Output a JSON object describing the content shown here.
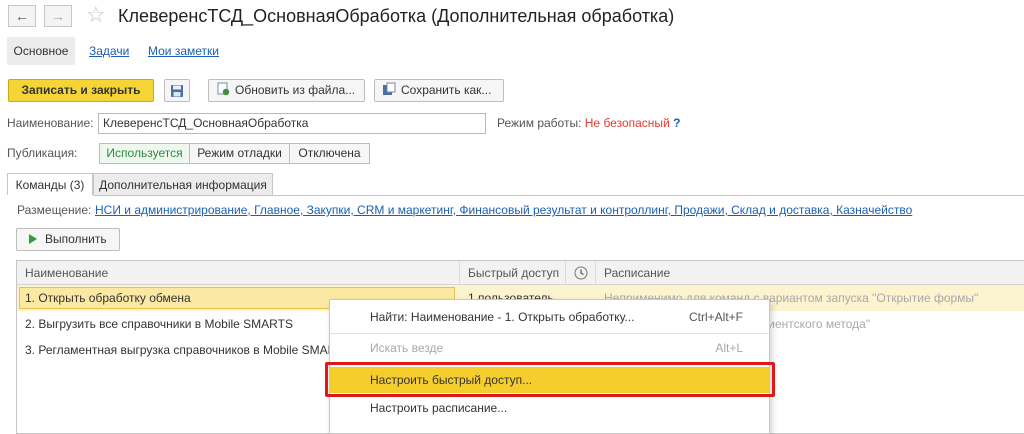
{
  "window": {
    "title": "КлеверенсТСД_ОсновнаяОбработка (Дополнительная обработка)",
    "back_icon": "←",
    "forward_icon": "→",
    "favorite_icon": "☆"
  },
  "sections": {
    "active": "Основное",
    "links": [
      "Задачи",
      "Мои заметки"
    ]
  },
  "toolbar": {
    "save_close": "Записать и закрыть",
    "update_from_file": "Обновить из файла...",
    "save_as": "Сохранить как..."
  },
  "form": {
    "name_label": "Наименование:",
    "name_value": "КлеверенсТСД_ОсновнаяОбработка",
    "mode_label": "Режим работы:",
    "mode_value": "Не безопасный",
    "mode_help": "?",
    "publication_label": "Публикация:",
    "publication_options": [
      "Используется",
      "Режим отладки",
      "Отключена"
    ],
    "publication_selected": "Используется"
  },
  "form_tabs": [
    "Команды (3)",
    "Дополнительная информация"
  ],
  "commands": {
    "placement_label": "Размещение:",
    "placement_value": "НСИ и администрирование, Главное, Закупки, CRM и маркетинг, Финансовый результат и контроллинг, Продажи, Склад и доставка, Казначейство",
    "run_button": "Выполнить",
    "table": {
      "columns": [
        "Наименование",
        "Быстрый доступ",
        "",
        "Расписание"
      ],
      "rows": [
        {
          "name": "1. Открыть обработку обмена",
          "quick_access": "1 пользователь",
          "schedule": "Неприменимо для команд с вариантом запуска \"Открытие формы\""
        },
        {
          "name": "2. Выгрузить все справочники в Mobile SMARTS",
          "quick_access": "",
          "schedule": "вариантом запуска \"Вызов клиентского метода\""
        },
        {
          "name": "3. Регламентная выгрузка справочников в Mobile SMARTS",
          "quick_access": "",
          "schedule": ""
        }
      ]
    }
  },
  "context_menu": {
    "items": [
      {
        "label": "Найти: Наименование - 1. Открыть обработку...",
        "shortcut": "Ctrl+Alt+F"
      },
      {
        "label": "Искать везде",
        "shortcut": "Alt+L"
      },
      {
        "label": "Настроить быстрый доступ...",
        "shortcut": ""
      },
      {
        "label": "Настроить расписание...",
        "shortcut": ""
      }
    ]
  },
  "colors": {
    "accent_yellow": "#f5cd2d",
    "link_blue": "#1a5fb4",
    "warning_red": "#e23b2f",
    "highlight_frame": "#e01818",
    "active_green": "#2e8b3a"
  }
}
